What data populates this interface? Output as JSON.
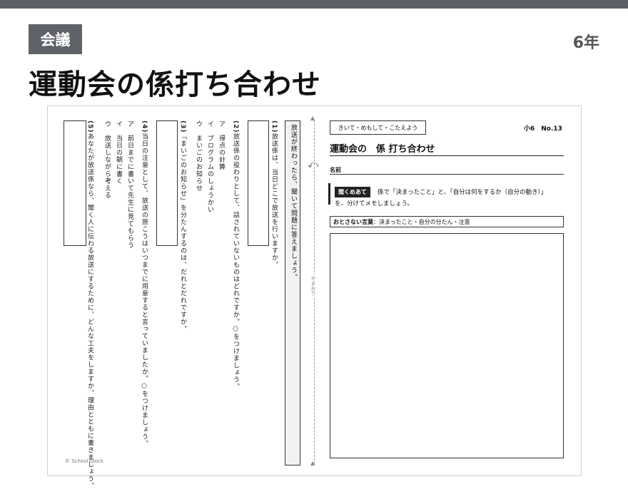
{
  "header": {
    "category_badge": "会議",
    "grade": "6年",
    "title": "運動会の係打ち合わせ"
  },
  "sheet": {
    "copyright": "© School Stock",
    "notice": "放送が終わったら、聞いて問題に答えましょう。",
    "q1": {
      "number": "(1)",
      "text": "放送係は、当日どこで放送を行いますか。"
    },
    "q2": {
      "number": "(2)",
      "text": "放送係の役わりとして、話されていないものはどれですか。○をつけましょう。",
      "options": [
        "ア　得点の計算",
        "イ　プログラムのしょうかい",
        "ウ　まいごのお知らせ"
      ]
    },
    "q3": {
      "number": "(3)",
      "text": "「まいごのお知らせ」を分たんするのは、だれとだれですか。"
    },
    "q4": {
      "number": "(4)",
      "text": "当日の注意として、放送の原こうはいつまでに用意すると言っていましたか。○をつけましょう。",
      "options": [
        "ア　前日までに書いて先生に見てもらう",
        "イ　当日の朝に書く",
        "ウ　放送しながら考える"
      ]
    },
    "q5": {
      "number": "(5)",
      "text": "あなたが放送係なら、聞く人に伝わる放送にするために、どんな工夫をしますか。理由とともに書きましょう。"
    },
    "fold_label": "やまおり",
    "tag": "きいて・めもして・こたえよう",
    "number": "小6　No.13",
    "sheet_title": "運動会の　係 打ち合わせ",
    "name_label": "名前",
    "instruction_tag": "聞くめあて",
    "instruction_line1": "係で「決まったこと」と、「自分は何をするか（自分の動き）」",
    "instruction_line2": "を、分けてメモしましょう。",
    "words_label": "おとさない言葉",
    "words_text": "：決まったこと・自分の分たん・注意"
  }
}
